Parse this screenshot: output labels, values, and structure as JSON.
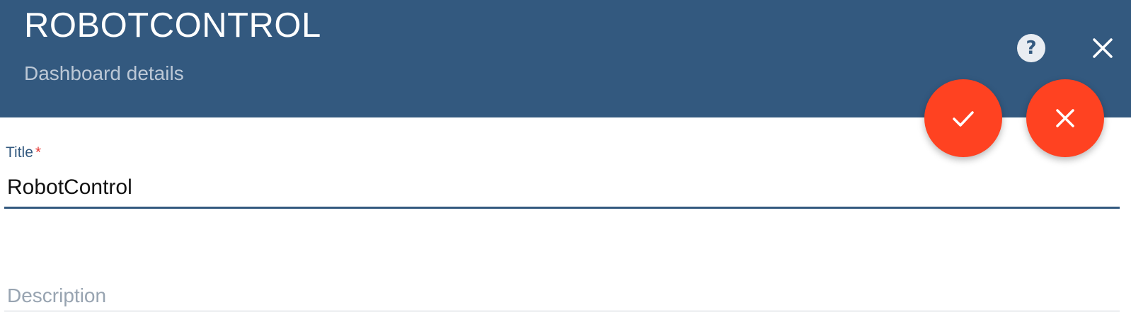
{
  "header": {
    "title": "ROBOTCONTROL",
    "subtitle": "Dashboard details",
    "help_icon": "help-circle-icon",
    "close_icon": "close-icon"
  },
  "actions": {
    "save_icon": "check-icon",
    "cancel_icon": "close-icon"
  },
  "form": {
    "title_field": {
      "label": "Title",
      "required_mark": "*",
      "value": "RobotControl"
    },
    "description_field": {
      "placeholder": "Description",
      "value": ""
    }
  },
  "colors": {
    "header_bg": "#33597f",
    "fab_bg": "#ff4221",
    "required": "#e53935"
  }
}
